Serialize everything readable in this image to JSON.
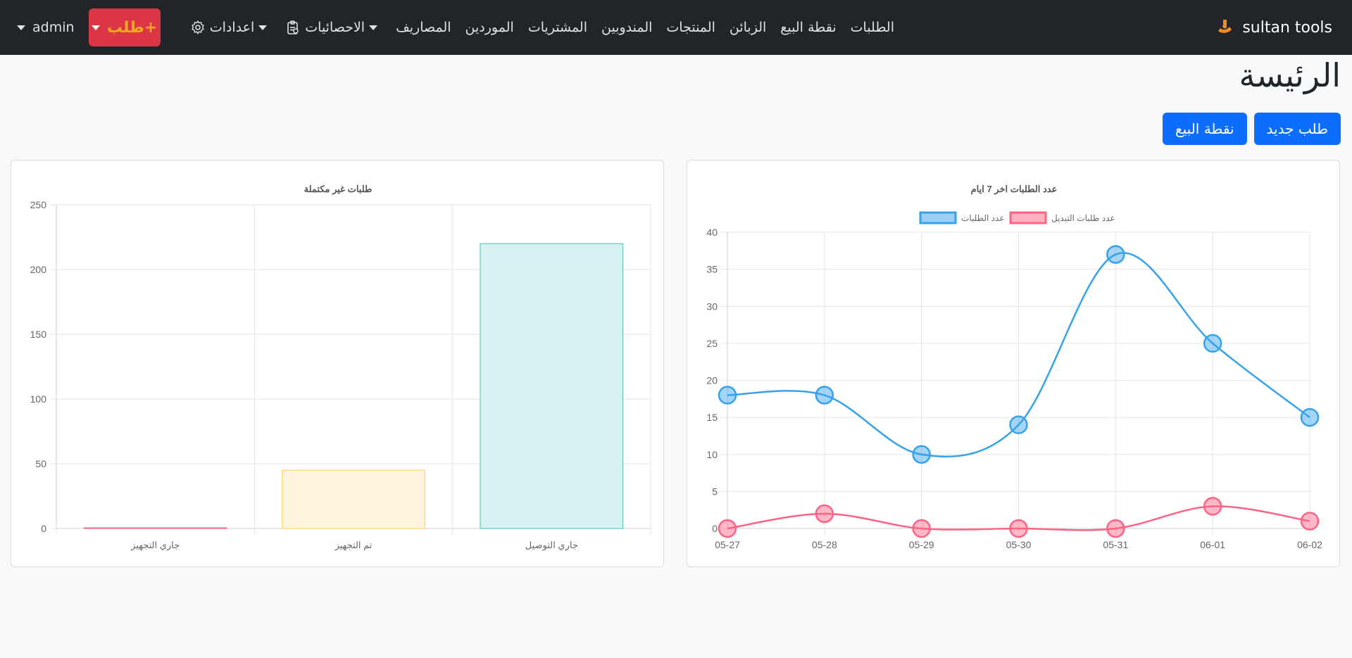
{
  "nav": {
    "brand": "sultan tools",
    "items": [
      {
        "name": "nav-orders",
        "label": "الطلبات"
      },
      {
        "name": "nav-pos",
        "label": "نقطة البيع"
      },
      {
        "name": "nav-customers",
        "label": "الزبائن"
      },
      {
        "name": "nav-products",
        "label": "المنتجات"
      },
      {
        "name": "nav-delegates",
        "label": "المندوبين"
      },
      {
        "name": "nav-purchases",
        "label": "المشتريات"
      },
      {
        "name": "nav-suppliers",
        "label": "الموردين"
      },
      {
        "name": "nav-expenses",
        "label": "المصاريف"
      }
    ],
    "stats_label": "الاحصائيات",
    "settings_label": "اعدادات",
    "order_button_label": "طلب+",
    "user_label": "admin"
  },
  "page": {
    "title": "الرئيسة",
    "new_order_button": "طلب جديد",
    "pos_button": "نقطة البيع"
  },
  "colors": {
    "primary": "#0d6efd",
    "danger": "#dc3545",
    "navbar": "#212529",
    "series_orders": "#36a2eb",
    "series_exchange": "#ff6384"
  },
  "chart_data": [
    {
      "type": "line",
      "title": "عدد الطلبات اخر 7 ايام",
      "categories": [
        "05-27",
        "05-28",
        "05-29",
        "05-30",
        "05-31",
        "06-01",
        "06-02"
      ],
      "series": [
        {
          "name": "عدد الطلبات",
          "values": [
            18,
            18,
            10,
            14,
            37,
            25,
            15
          ],
          "color": "#36a2eb"
        },
        {
          "name": "عدد طلبات التبديل",
          "values": [
            0,
            2,
            0,
            0,
            0,
            3,
            1
          ],
          "color": "#ff6384"
        }
      ],
      "ylim": [
        0,
        40
      ],
      "y_ticks": [
        0,
        5,
        10,
        15,
        20,
        25,
        30,
        35,
        40
      ],
      "grid": true,
      "legend": "top-center"
    },
    {
      "type": "bar",
      "title": "طلبات غير مكتملة",
      "categories": [
        "جاري التوصيل",
        "تم التجهيز",
        "جاري التجهيز"
      ],
      "values": [
        220,
        45,
        0
      ],
      "bar_colors": [
        {
          "fill": "#d8f1f1",
          "stroke": "#4bc0c0"
        },
        {
          "fill": "#fff5dd",
          "stroke": "#ffcd56"
        },
        {
          "fill": "#ffe0e6",
          "stroke": "#ff6384"
        }
      ],
      "ylim": [
        0,
        250
      ],
      "y_ticks": [
        0,
        50,
        100,
        150,
        200,
        250
      ],
      "grid": true
    }
  ]
}
